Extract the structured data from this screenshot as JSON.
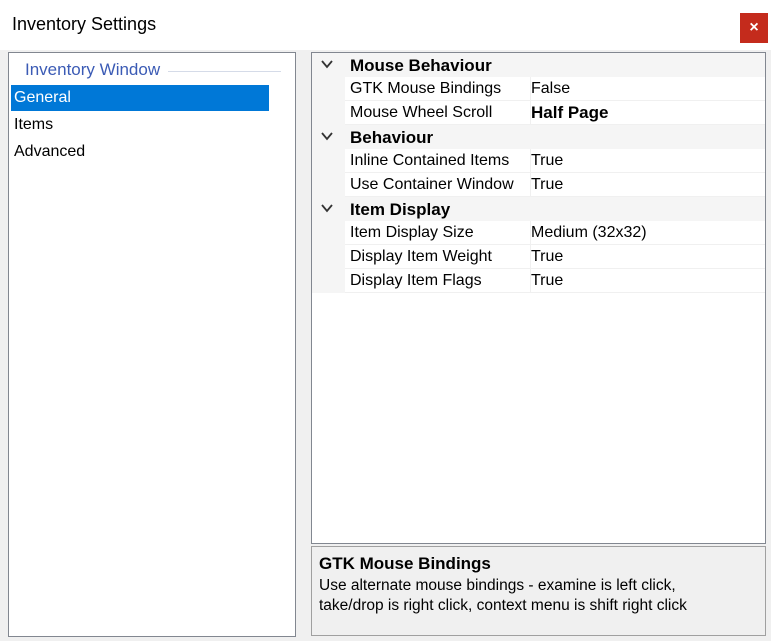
{
  "window": {
    "title": "Inventory Settings",
    "close_glyph": "×"
  },
  "sidebar": {
    "group_label": "Inventory Window",
    "items": [
      {
        "label": "General",
        "selected": true
      },
      {
        "label": "Items",
        "selected": false
      },
      {
        "label": "Advanced",
        "selected": false
      }
    ]
  },
  "grid": {
    "categories": [
      {
        "label": "Mouse Behaviour",
        "icon": "chevron-down-icon",
        "properties": [
          {
            "name": "GTK Mouse Bindings",
            "value": "False",
            "bold": false
          },
          {
            "name": "Mouse Wheel Scroll",
            "value": "Half Page",
            "bold": true
          }
        ]
      },
      {
        "label": "Behaviour",
        "icon": "chevron-down-icon",
        "properties": [
          {
            "name": "Inline Contained Items",
            "value": "True",
            "bold": false
          },
          {
            "name": "Use Container Window",
            "value": "True",
            "bold": false
          }
        ]
      },
      {
        "label": "Item Display",
        "icon": "chevron-down-icon",
        "properties": [
          {
            "name": "Item Display Size",
            "value": "Medium (32x32)",
            "bold": false
          },
          {
            "name": "Display Item Weight",
            "value": "True",
            "bold": false
          },
          {
            "name": "Display Item Flags",
            "value": "True",
            "bold": false
          }
        ]
      }
    ]
  },
  "description": {
    "title": "GTK Mouse Bindings",
    "text_line1": "Use alternate mouse bindings - examine is left click,",
    "text_line2": "take/drop is right click, context menu is shift right click"
  },
  "colors": {
    "selection": "#0078d7",
    "group_label": "#3b5bb5",
    "close_button": "#c42b1c"
  }
}
